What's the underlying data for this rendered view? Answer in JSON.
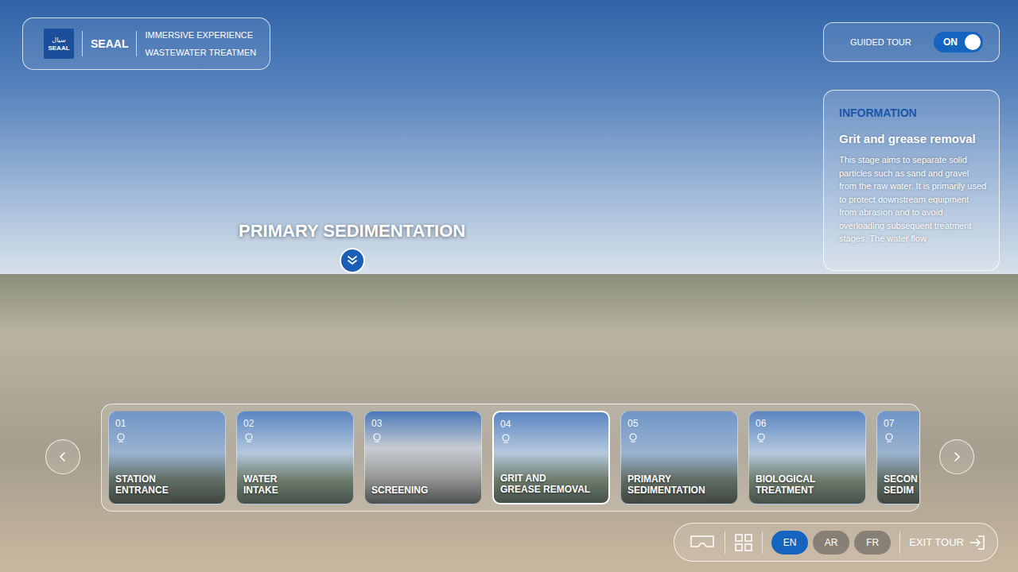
{
  "header": {
    "logo_arabic": "سيال",
    "logo": "SEAAL",
    "brand": "SEAAL",
    "line1": "IMMERSIVE EXPERIENCE",
    "line2": "WASTEWATER TREATMEN"
  },
  "guided_tour": {
    "label": "GUIDED TOUR",
    "on": true,
    "state_text": "ON"
  },
  "info": {
    "heading": "INFORMATION",
    "title": "Grit and grease removal",
    "body": "This stage aims to separate solid particles such as sand and gravel from the raw water. It is primarily used to protect downstream equipment from abrasion and to avoid overloading subsequent treatment stages. The water flow"
  },
  "hotspot": {
    "label": "PRIMARY SEDIMENTATION"
  },
  "stages": [
    {
      "number": "01",
      "label": "STATION\nENTRANCE",
      "selected": false
    },
    {
      "number": "02",
      "label": "WATER\nINTAKE",
      "selected": false
    },
    {
      "number": "03",
      "label": "SCREENING",
      "selected": false
    },
    {
      "number": "04",
      "label": "GRIT AND\nGREASE REMOVAL",
      "selected": true
    },
    {
      "number": "05",
      "label": "PRIMARY\nSEDIMENTATION",
      "selected": false
    },
    {
      "number": "06",
      "label": "BIOLOGICAL\nTREATMENT",
      "selected": false
    },
    {
      "number": "07",
      "label": "SECON\nSEDIM",
      "selected": false
    }
  ],
  "languages": [
    {
      "code": "EN",
      "selected": true
    },
    {
      "code": "AR",
      "selected": false
    },
    {
      "code": "FR",
      "selected": false
    }
  ],
  "exit": "EXIT TOUR"
}
